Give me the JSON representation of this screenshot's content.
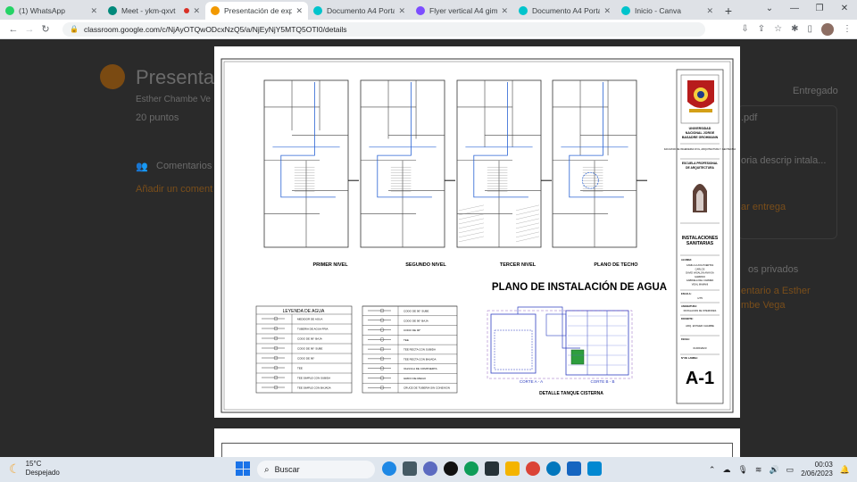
{
  "tabs": [
    {
      "title": "(1) WhatsApp",
      "color": "#25d366",
      "active": false
    },
    {
      "title": "Meet - ykm-qxvt",
      "color": "#00897b",
      "active": false
    },
    {
      "title": "Presentación de expe",
      "color": "#f29900",
      "active": true
    },
    {
      "title": "Documento A4 Portad",
      "color": "#00c4cc",
      "active": false
    },
    {
      "title": "Flyer vertical A4 gim",
      "color": "#7c4dff",
      "active": false
    },
    {
      "title": "Documento A4 Portad",
      "color": "#00c4cc",
      "active": false
    },
    {
      "title": "Inicio - Canva",
      "color": "#00c4cc",
      "active": false
    }
  ],
  "url": "classroom.google.com/c/NjAyOTQwODcxNzQ5/a/NjEyNjY5MTQ5OTI0/details",
  "classroom": {
    "title": "Presenta",
    "author": "Esther Chambe Ve",
    "points": "20 puntos",
    "comments": "Comentarios",
    "add_comment": "Añadir un coment",
    "delivered": "Entregado",
    "pdf": ".pdf",
    "desc": "oria descrip intala...",
    "add_delivery": "ar entrega",
    "private": "os privados",
    "comment_line1": "entario a Esther",
    "comment_line2": "mbe Vega"
  },
  "plan": {
    "level_labels": [
      "PRIMER NIVEL",
      "SEGUNDO NIVEL",
      "TERCER NIVEL",
      "PLANO DE TECHO"
    ],
    "main_title": "PLANO DE INSTALACIÓN DE AGUA",
    "legend_title": "LEYENDA DE AGUA",
    "legend_left": [
      "MEDIDOR DE AGUA",
      "TUBERIA DE AGUA FRIA",
      "CODO DE 90° BAJA",
      "CODO DE 90° SUBE",
      "CODO DE 90°",
      "TEE",
      "TEE SIMPLE CON SUBIDA",
      "TEE SIMPLE CON BAJADA"
    ],
    "legend_right": [
      "CODO DE 90° SUBE",
      "CODO DE 90° BAJA",
      "CODO DE 90°",
      "TEE",
      "TEE RECTA CON SUBIDA",
      "TEE RECTA CON BAJADA",
      "VALVULA DE COMPUERTA",
      "GRIFO DE RIEGO",
      "CRUCE DE TUBERIA SIN CONEXION"
    ],
    "section_a": "CORTE A - A",
    "section_b": "CORTE B - B",
    "detail_title": "DETALLE TANQUE CISTERNA",
    "university": [
      "UNIVERSIDAD",
      "NACIONAL JORGE",
      "BASADRE GROHMANN"
    ],
    "faculty": "FACULTAD DE INGENIERIA CIVIL, ARQUITECTURA Y GEOTECNIA",
    "school": [
      "ESCUELA PROFESIONAL",
      "DE ARQUITECTURA"
    ],
    "sheet_subject": [
      "INSTALACIONES",
      "SANITARIAS"
    ],
    "student_label": "ALUMNA:",
    "students": [
      "CAMILA LUCIA PUERTAS",
      "CARLOS",
      "DAVID VASALON ANAYSA",
      "GARRIDO",
      "GABRIELA DEL CARMEN",
      "VIDAL MAMANI"
    ],
    "scale_label": "ESCALA:",
    "scale": "1/75",
    "course_label": "ASIGNATURA:",
    "course": "INSTALACION DE INTERIORES",
    "teacher_label": "DOCENTE:",
    "teacher": "ARQ. ESTHER CHAMBE",
    "date_label": "FECHA:",
    "date": "01/06/2023",
    "sheet_label": "Nº DE LAMINA:",
    "sheet_code": "A-1"
  },
  "taskbar": {
    "temp": "15°C",
    "weather": "Despejado",
    "search": "Buscar",
    "time": "00:03",
    "date": "2/06/2023"
  }
}
